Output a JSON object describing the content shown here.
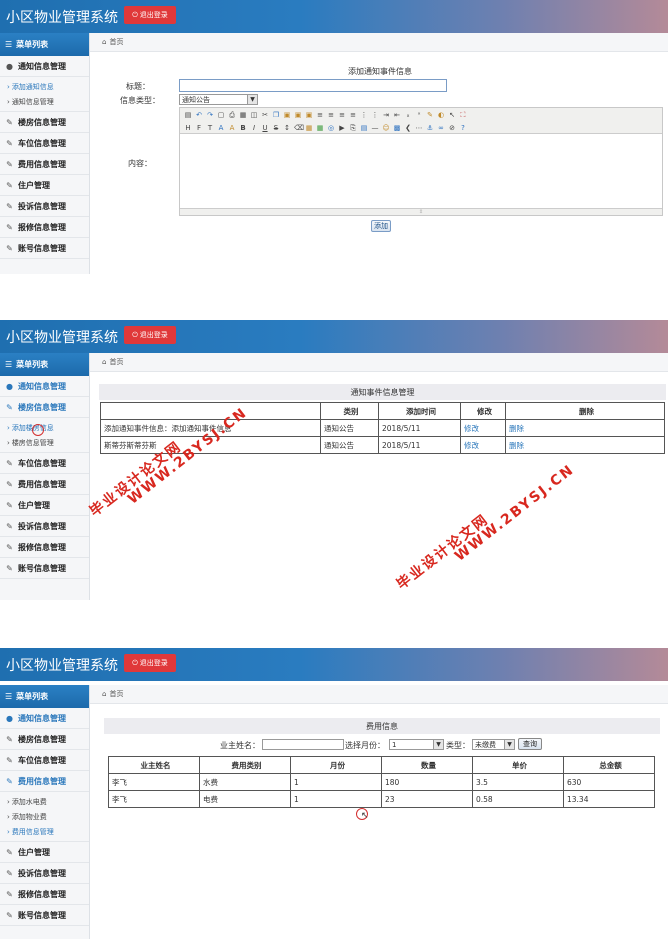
{
  "app_title": "小区物业管理系统",
  "logout_label": "退出登录",
  "menu_title": "菜单列表",
  "breadcrumb_home": "首页",
  "nav_labels": [
    "通知信息管理",
    "楼房信息管理",
    "车位信息管理",
    "费用信息管理",
    "住户管理",
    "投诉信息管理",
    "报修信息管理",
    "账号信息管理"
  ],
  "panel1": {
    "submenu": [
      "添加通知信息",
      "通知信息管理"
    ],
    "form_title": "添加通知事件信息",
    "title_label": "标题：",
    "type_label": "信息类型：",
    "type_value": "通知公告",
    "content_label": "内容：",
    "add_button": "添加"
  },
  "panel2": {
    "submenu": [
      "添加楼房信息",
      "楼房信息管理"
    ],
    "section_title": "通知事件信息管理",
    "columns": [
      "",
      "类别",
      "添加时间",
      "修改",
      "删除"
    ],
    "rows": [
      {
        "title": "添加通知事件信息：添加通知事件信息",
        "type": "通知公告",
        "time": "2018/5/11",
        "edit": "修改",
        "delete": "删除"
      },
      {
        "title": "斯蒂芬斯蒂芬斯",
        "type": "通知公告",
        "time": "2018/5/11",
        "edit": "修改",
        "delete": "删除"
      }
    ]
  },
  "panel3": {
    "submenu": [
      "添加水电费",
      "添加物业费",
      "费用信息管理"
    ],
    "section_title": "费用信息",
    "owner_label": "业主姓名：",
    "month_label": "选择月份：",
    "month_value": "1",
    "type_label": "类型：",
    "type_value": "未缴费",
    "query_button": "查询",
    "columns": [
      "业主姓名",
      "费用类别",
      "月份",
      "数量",
      "单价",
      "总金额"
    ],
    "rows": [
      {
        "owner": "李飞",
        "category": "水费",
        "month": "1",
        "qty": "180",
        "price": "3.5",
        "total": "630"
      },
      {
        "owner": "李飞",
        "category": "电费",
        "month": "1",
        "qty": "23",
        "price": "0.58",
        "total": "13.34"
      }
    ]
  },
  "watermark_site": "WWW.2BYSJ.CN",
  "watermark_cn": "毕业设计论文网"
}
